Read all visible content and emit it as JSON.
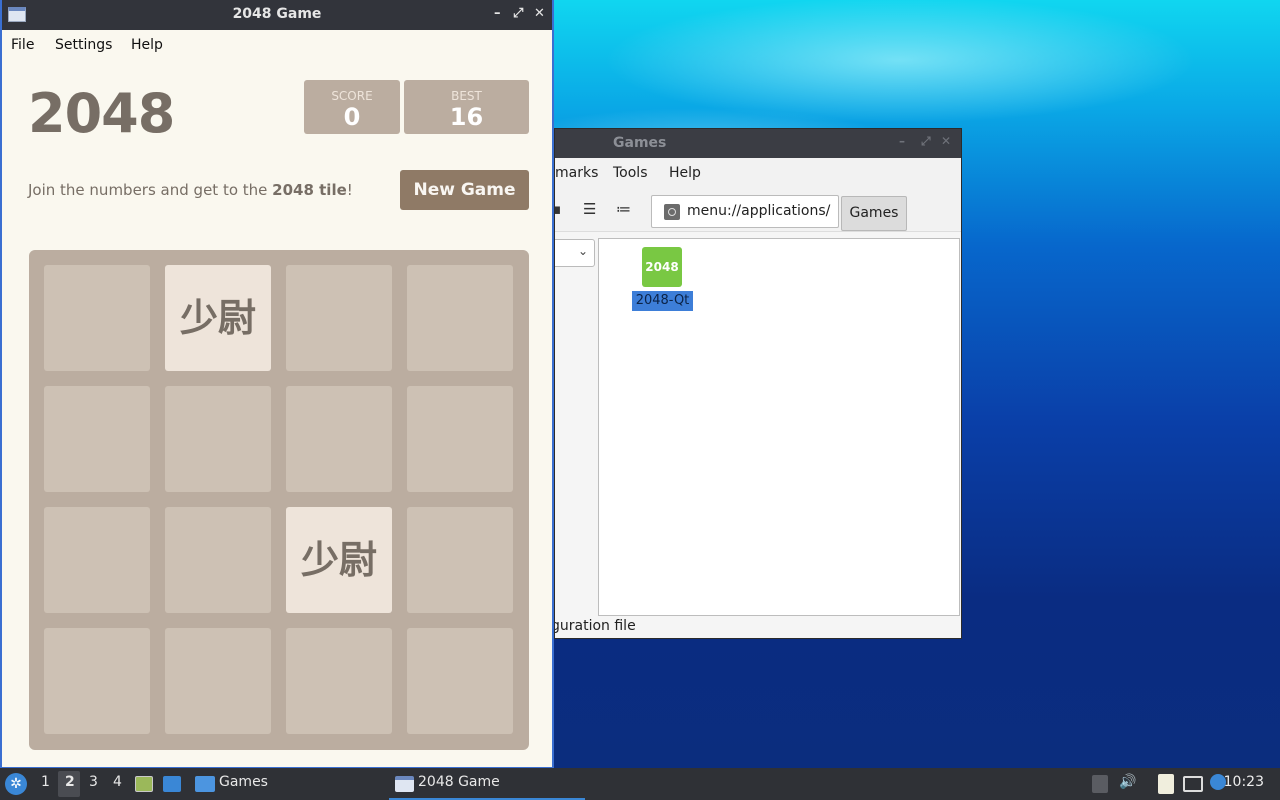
{
  "file_manager": {
    "title": "Games",
    "controls": [
      "–",
      "⤢",
      "✕"
    ],
    "menu": [
      "marks",
      "Tools",
      "Help"
    ],
    "path": "menu://applications/",
    "breadcrumb": "Games",
    "app_icon_text": "2048",
    "app_label": "2048-Qt",
    "status": "guration file"
  },
  "game": {
    "window_title": "2048 Game",
    "controls": [
      "–",
      "⤢",
      "✕"
    ],
    "menu": [
      "File",
      "Settings",
      "Help"
    ],
    "title": "2048",
    "score_label": "SCORE",
    "score_value": "0",
    "best_label": "BEST",
    "best_value": "16",
    "intro_prefix": "Join the numbers and get to the ",
    "intro_bold": "2048 tile",
    "intro_suffix": "!",
    "new_game_label": "New Game",
    "tile_text": "少尉",
    "board_rows": [
      [
        "",
        "少尉",
        "",
        ""
      ],
      [
        "",
        "",
        "",
        ""
      ],
      [
        "",
        "",
        "少尉",
        ""
      ],
      [
        "",
        "",
        "",
        ""
      ]
    ]
  },
  "taskbar": {
    "workspaces": [
      "1",
      "2",
      "3",
      "4"
    ],
    "active_workspace": "2",
    "tasks": [
      "Games",
      "2048 Game"
    ],
    "clock": "10:23"
  },
  "colors": {
    "tile": "#eee4da",
    "cell": "#cdc1b4",
    "board": "#bbada0",
    "new_game": "#8f7a66",
    "selection": "#3d7ed8"
  }
}
